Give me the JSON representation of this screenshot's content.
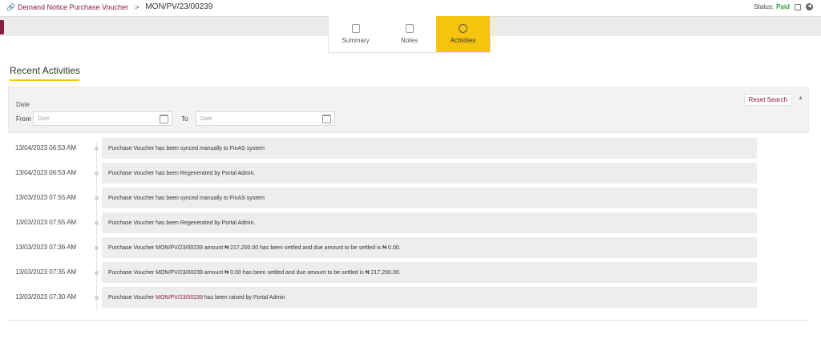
{
  "breadcrumb": {
    "parent": "Demand Notice Purchase Voucher",
    "separator": ">",
    "current": "MON/PV/23/00239"
  },
  "status": {
    "label": "Status:",
    "value": "Paid"
  },
  "tabs": [
    {
      "label": "Summary",
      "icon": "summary-icon",
      "active": false
    },
    {
      "label": "Notes",
      "icon": "notes-icon",
      "active": false
    },
    {
      "label": "Activities",
      "icon": "activities-icon",
      "active": true
    }
  ],
  "section": {
    "title": "Recent Activities"
  },
  "filter": {
    "date_label": "Date",
    "from_label": "From",
    "to_label": "To",
    "from_placeholder": "Date",
    "to_placeholder": "Date",
    "reset_label": "Reset Search"
  },
  "activities": [
    {
      "time": "13/04/2023 06:53 AM",
      "text": "Purchase Voucher has been synced manually to FinAS system"
    },
    {
      "time": "13/04/2023 06:53 AM",
      "text": "Purchase Voucher has been Regenerated by Portal Admin."
    },
    {
      "time": "13/03/2023 07:55 AM",
      "text": "Purchase Voucher has been synced manually to FinAS system"
    },
    {
      "time": "13/03/2023 07:55 AM",
      "text": "Purchase Voucher has been Regenerated by Portal Admin."
    },
    {
      "time": "13/03/2023 07:36 AM",
      "text": "Purchase Voucher MON/PV/23/00239 amount ₦ 217,200.00 has been settled and due amount to be settled is ₦ 0.00."
    },
    {
      "time": "13/03/2023 07:35 AM",
      "text": "Purchase Voucher MON/PV/23/00239 amount ₦ 0.00 has been settled and due amount to be settled is ₦ 217,200.00."
    },
    {
      "time": "13/03/2023 07:30 AM",
      "text_before": "Purchase Voucher ",
      "ref": "MON/PV/23/00239",
      "text_after": " has been raised by Portal Admin"
    }
  ],
  "colors": {
    "brand": "#8b1c3d",
    "accent": "#f6c40f",
    "paid": "#2e9b3a"
  }
}
